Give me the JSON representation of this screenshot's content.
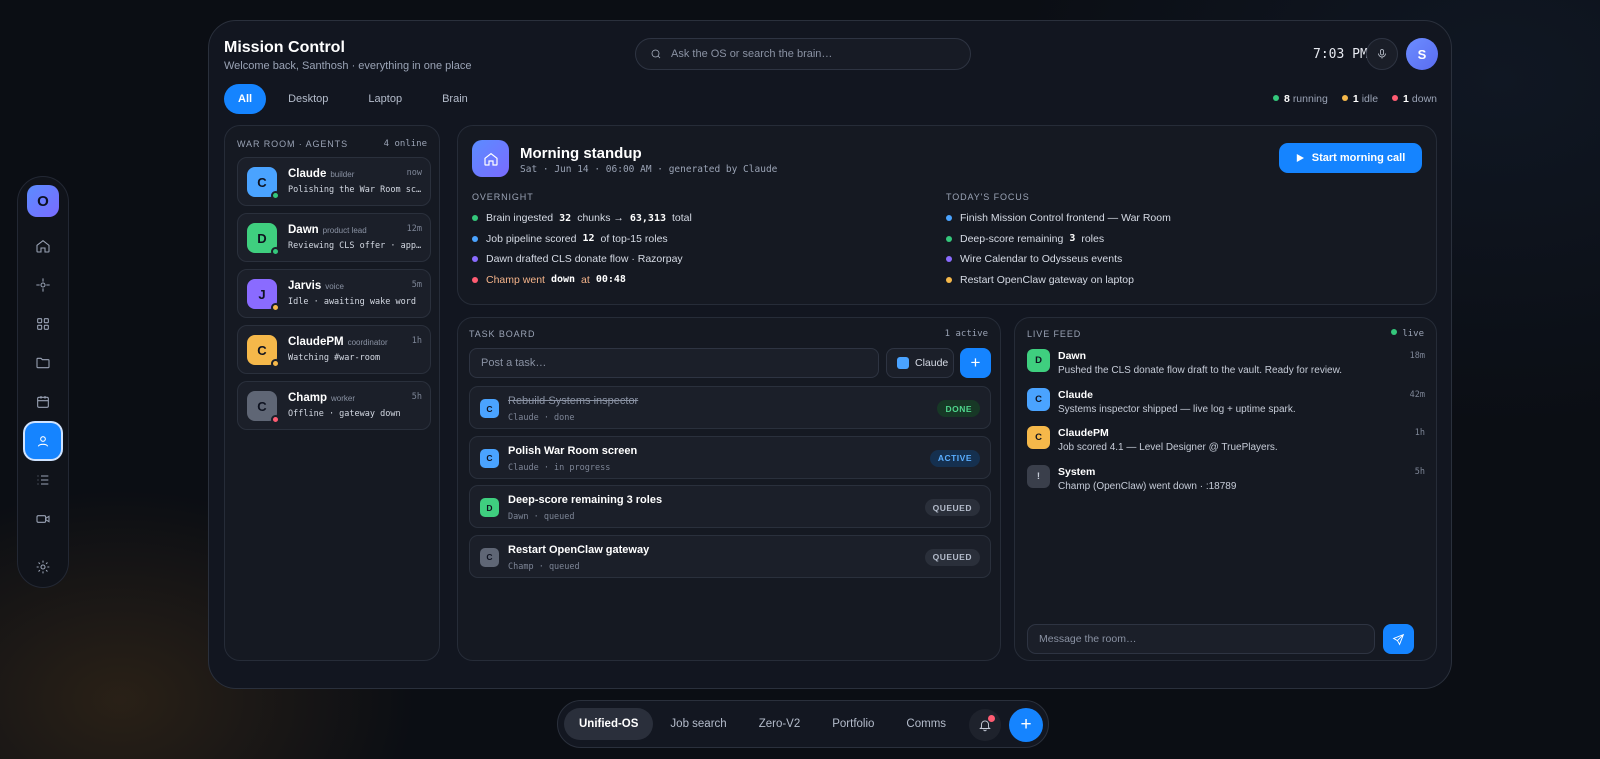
{
  "colors": {
    "accent": "#1584ff",
    "green": "#34c77b",
    "amber": "#f5b84a",
    "red": "#ff5c72",
    "blue": "#4aa3ff",
    "purple": "#7b6bff"
  },
  "rail": {
    "logo": "O",
    "items": [
      {
        "icon": "home-icon"
      },
      {
        "icon": "crosshair-icon"
      },
      {
        "icon": "grid-icon"
      },
      {
        "icon": "folder-icon"
      },
      {
        "icon": "calendar-icon"
      },
      {
        "icon": "user-icon",
        "active": true
      },
      {
        "icon": "list-icon"
      },
      {
        "icon": "video-icon"
      },
      {
        "icon": "gear-icon"
      }
    ]
  },
  "header": {
    "title": "Mission Control",
    "subtitle": "Welcome back, Santhosh · everything in one place",
    "search_placeholder": "Ask the OS or search the brain…",
    "time": "7:03 PM",
    "avatar": "S"
  },
  "tabs": [
    "All",
    "Desktop",
    "Laptop",
    "Brain"
  ],
  "status": {
    "running_count": "8",
    "running_label": "running",
    "idle_count": "1",
    "idle_label": "idle",
    "down_count": "1",
    "down_label": "down"
  },
  "war_room": {
    "header": "WAR ROOM · AGENTS",
    "online": "4 online",
    "agents": [
      {
        "initial": "C",
        "name": "Claude",
        "role": "builder",
        "time": "now",
        "status": "Polishing the War Room screen",
        "color": "#4aa3ff",
        "state": "#34c77b"
      },
      {
        "initial": "D",
        "name": "Dawn",
        "role": "product lead",
        "time": "12m",
        "status": "Reviewing CLS offer · approved",
        "color": "#3fcf7f",
        "state": "#34c77b"
      },
      {
        "initial": "J",
        "name": "Jarvis",
        "role": "voice",
        "time": "5m",
        "status": "Idle · awaiting wake word",
        "color": "#8a6bff",
        "state": "#f5b84a"
      },
      {
        "initial": "C",
        "name": "ClaudePM",
        "role": "coordinator",
        "time": "1h",
        "status": "Watching #war-room",
        "color": "#f5b84a",
        "state": "#f5b84a"
      },
      {
        "initial": "C",
        "name": "Champ",
        "role": "worker",
        "time": "5h",
        "status": "Offline · gateway down",
        "color": "#5f6675",
        "state": "#ff5c72"
      }
    ]
  },
  "standup": {
    "title": "Morning standup",
    "meta": "Sat · Jun 14 · 06:00 AM · generated by Claude",
    "button": "Start morning call",
    "overnight_label": "OVERNIGHT",
    "focus_label": "TODAY'S FOCUS",
    "overnight": [
      {
        "a": "Brain ingested",
        "n1": "32",
        "b": "chunks →",
        "n2": "63,313",
        "c": "total",
        "dot": "#34c77b"
      },
      {
        "a": "Job pipeline scored",
        "n1": "12",
        "b": "of top-15 roles",
        "n2": "",
        "c": "",
        "dot": "#4aa3ff"
      },
      {
        "a": "Dawn drafted CLS donate flow · Razorpay",
        "n1": "",
        "b": "",
        "n2": "",
        "c": "",
        "dot": "#8a6bff"
      },
      {
        "a": "Champ went",
        "n1": "down",
        "b": "at",
        "n2": "00:48",
        "c": "",
        "dot": "#ff5c72",
        "warn": true
      }
    ],
    "focus": [
      {
        "a": "Finish Mission Control frontend — War Room",
        "n1": "",
        "b": "",
        "dot": "#4aa3ff"
      },
      {
        "a": "Deep-score remaining",
        "n1": "3",
        "b": "roles",
        "dot": "#34c77b"
      },
      {
        "a": "Wire Calendar to Odysseus events",
        "n1": "",
        "b": "",
        "dot": "#8a6bff"
      },
      {
        "a": "Restart OpenClaw gateway on laptop",
        "n1": "",
        "b": "",
        "dot": "#f5b84a"
      }
    ]
  },
  "task_board": {
    "header": "TASK BOARD",
    "active": "1 active",
    "placeholder": "Post a task…",
    "assignee": "Claude",
    "add": "+",
    "tasks": [
      {
        "initial": "C",
        "title": "Rebuild Systems inspector",
        "sub": "Claude · done",
        "badge": "DONE",
        "done": true,
        "color": "#4aa3ff",
        "badge_bg": "#173826",
        "badge_fg": "#4fd68c"
      },
      {
        "initial": "C",
        "title": "Polish War Room screen",
        "sub": "Claude · in progress",
        "badge": "ACTIVE",
        "done": false,
        "color": "#4aa3ff",
        "badge_bg": "#15304f",
        "badge_fg": "#5aaeff"
      },
      {
        "initial": "D",
        "title": "Deep-score remaining 3 roles",
        "sub": "Dawn · queued",
        "badge": "QUEUED",
        "done": false,
        "color": "#3fcf7f",
        "badge_bg": "#2a2f3a",
        "badge_fg": "#b4bccb"
      },
      {
        "initial": "C",
        "title": "Restart OpenClaw gateway",
        "sub": "Champ · queued",
        "badge": "QUEUED",
        "done": false,
        "color": "#5f6675",
        "badge_bg": "#2a2f3a",
        "badge_fg": "#b4bccb"
      }
    ]
  },
  "live_feed": {
    "header": "LIVE FEED",
    "live": "live",
    "placeholder": "Message the room…",
    "items": [
      {
        "initial": "D",
        "name": "Dawn",
        "msg": "Pushed the CLS donate flow draft to the vault. Ready for review.",
        "time": "18m",
        "color": "#3fcf7f"
      },
      {
        "initial": "C",
        "name": "Claude",
        "msg": "Systems inspector shipped — live log + uptime spark.",
        "time": "42m",
        "color": "#4aa3ff"
      },
      {
        "initial": "C",
        "name": "ClaudePM",
        "msg": "Job scored 4.1 — Level Designer @ TruePlayers.",
        "time": "1h",
        "color": "#f5b84a"
      },
      {
        "initial": "!",
        "name": "System",
        "msg": "Champ (OpenClaw) went down · :18789",
        "time": "5h",
        "color": "#3a3f4b"
      }
    ]
  },
  "dock": {
    "items": [
      "Unified-OS",
      "Job search",
      "Zero-V2",
      "Portfolio",
      "Comms"
    ],
    "fab": "+"
  }
}
